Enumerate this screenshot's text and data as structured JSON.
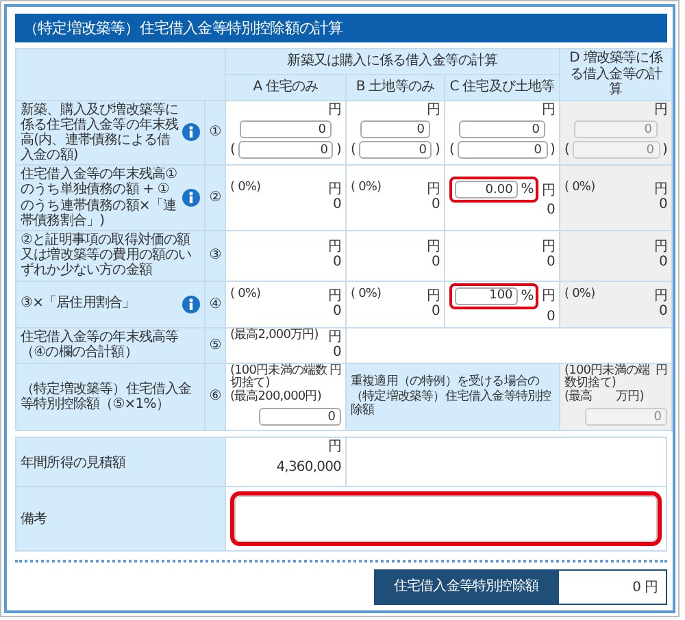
{
  "title": "（特定増改築等）住宅借入金等特別控除額の計算",
  "table": {
    "group_header": "新築又は購入に係る借入金等の計算",
    "columns": [
      "A 住宅のみ",
      "B 土地等のみ",
      "C 住宅及び土地等",
      "D 増改築等に係る借入金等の計算"
    ],
    "rows": [
      {
        "label": "新築、購入及び増改築等に係る住宅借入金等の年末残高(内、連帯債務による借入金の額)",
        "info": true,
        "number": "①",
        "cells": [
          {
            "kind": "pair",
            "unit": "円",
            "value": "0",
            "open": "(",
            "sub_value": "0",
            "close": ")",
            "disabled": false
          },
          {
            "kind": "pair",
            "unit": "円",
            "value": "0",
            "open": "(",
            "sub_value": "0",
            "close": ")",
            "disabled": false
          },
          {
            "kind": "pair",
            "unit": "円",
            "value": "0",
            "open": "(",
            "sub_value": "0",
            "close": ")",
            "disabled": false
          },
          {
            "kind": "pair",
            "unit": "円",
            "value": "0",
            "open": "(",
            "sub_value": "0",
            "close": ")",
            "disabled": true
          }
        ]
      },
      {
        "label": "住宅借入金等の年末残高①のうち単独債務の額 + ①のうち連帯債務の額×「連帯債務割合」)",
        "info": true,
        "number": "②",
        "cells": [
          {
            "kind": "computed",
            "note": "( 0%)",
            "unit": "円",
            "value": "0",
            "disabled": false
          },
          {
            "kind": "computed",
            "note": "( 0%)",
            "unit": "円",
            "value": "0",
            "disabled": false
          },
          {
            "kind": "percent",
            "input": "0.00",
            "suffix": "%",
            "unit": "円",
            "value": "0",
            "highlighted": true,
            "disabled": false
          },
          {
            "kind": "computed",
            "note": "( 0%)",
            "unit": "円",
            "value": "0",
            "disabled": true
          }
        ]
      },
      {
        "label": "②と証明事項の取得対価の額又は増改築等の費用の額のいずれか少ない方の金額",
        "info": false,
        "number": "③",
        "cells": [
          {
            "kind": "computed",
            "unit": "円",
            "value": "0",
            "disabled": false
          },
          {
            "kind": "computed",
            "unit": "円",
            "value": "0",
            "disabled": false
          },
          {
            "kind": "computed",
            "unit": "円",
            "value": "0",
            "disabled": false
          },
          {
            "kind": "computed",
            "unit": "円",
            "value": "0",
            "disabled": true
          }
        ]
      },
      {
        "label": "③×「居住用割合」",
        "info": true,
        "number": "④",
        "cells": [
          {
            "kind": "computed",
            "note": "( 0%)",
            "unit": "円",
            "value": "0",
            "disabled": false
          },
          {
            "kind": "computed",
            "note": "( 0%)",
            "unit": "円",
            "value": "0",
            "disabled": false
          },
          {
            "kind": "percent",
            "input": "100",
            "suffix": "%",
            "unit": "円",
            "value": "0",
            "highlighted": true,
            "disabled": false
          },
          {
            "kind": "computed",
            "note": "( 0%)",
            "unit": "円",
            "value": "0",
            "disabled": true
          }
        ]
      },
      {
        "label": "住宅借入金等の年末残高等（④の欄の合計額）",
        "info": false,
        "number": "⑤",
        "cells": [
          {
            "kind": "computed",
            "note": "(最高2,000万円)",
            "unit": "円",
            "value": "0",
            "disabled": false
          },
          {
            "kind": "blank",
            "colspan": 3
          }
        ]
      },
      {
        "label": "（特定増改築等）住宅借入金等特別控除額（⑤×1%）",
        "info": false,
        "number": "⑥",
        "cells": [
          {
            "kind": "capped",
            "notes": [
              "(100円未満の端数切捨て)",
              "(最高200,000円)"
            ],
            "unit": "円",
            "value": "0",
            "disabled": false
          },
          {
            "kind": "label",
            "colspan": 2,
            "text": "重複適用（の特例）を受ける場合の（特定増改築等）住宅借入金等特別控除額"
          },
          {
            "kind": "capped",
            "notes": [
              "(100円未満の端数切捨て)",
              "(最高　　万円)"
            ],
            "unit": "円",
            "value": "0",
            "disabled": true
          }
        ]
      }
    ]
  },
  "income": {
    "label": "年間所得の見積額",
    "unit": "円",
    "value": "4,360,000"
  },
  "remarks": {
    "label": "備考",
    "highlighted": true
  },
  "result": {
    "label": "住宅借入金等特別控除額",
    "value": "0 円"
  }
}
